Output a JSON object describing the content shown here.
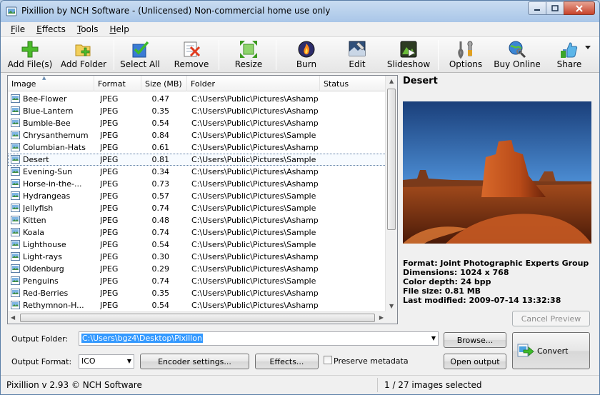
{
  "window": {
    "title": "Pixillion by NCH Software - (Unlicensed) Non-commercial home use only"
  },
  "menu": [
    {
      "first": "F",
      "rest": "ile"
    },
    {
      "first": "E",
      "rest": "ffects"
    },
    {
      "first": "T",
      "rest": "ools"
    },
    {
      "first": "H",
      "rest": "elp"
    }
  ],
  "toolbar": {
    "add_files": "Add File(s)",
    "add_folder": "Add Folder",
    "select_all": "Select All",
    "remove": "Remove",
    "resize": "Resize",
    "burn": "Burn",
    "edit": "Edit",
    "slideshow": "Slideshow",
    "options": "Options",
    "buy_online": "Buy Online",
    "share": "Share"
  },
  "list": {
    "columns": {
      "image": "Image",
      "format": "Format",
      "size": "Size (MB)",
      "folder": "Folder",
      "status": "Status"
    },
    "rows": [
      {
        "name": "Bee-Flower",
        "format": "JPEG",
        "size": "0.47",
        "folder": "C:\\Users\\Public\\Pictures\\Ashamp...",
        "status": ""
      },
      {
        "name": "Blue-Lantern",
        "format": "JPEG",
        "size": "0.35",
        "folder": "C:\\Users\\Public\\Pictures\\Ashamp...",
        "status": ""
      },
      {
        "name": "Bumble-Bee",
        "format": "JPEG",
        "size": "0.54",
        "folder": "C:\\Users\\Public\\Pictures\\Ashamp...",
        "status": ""
      },
      {
        "name": "Chrysanthemum",
        "format": "JPEG",
        "size": "0.84",
        "folder": "C:\\Users\\Public\\Pictures\\Sample ...",
        "status": ""
      },
      {
        "name": "Columbian-Hats",
        "format": "JPEG",
        "size": "0.61",
        "folder": "C:\\Users\\Public\\Pictures\\Ashamp...",
        "status": ""
      },
      {
        "name": "Desert",
        "format": "JPEG",
        "size": "0.81",
        "folder": "C:\\Users\\Public\\Pictures\\Sample ...",
        "status": ""
      },
      {
        "name": "Evening-Sun",
        "format": "JPEG",
        "size": "0.34",
        "folder": "C:\\Users\\Public\\Pictures\\Ashamp...",
        "status": ""
      },
      {
        "name": "Horse-in-the-...",
        "format": "JPEG",
        "size": "0.73",
        "folder": "C:\\Users\\Public\\Pictures\\Ashamp...",
        "status": ""
      },
      {
        "name": "Hydrangeas",
        "format": "JPEG",
        "size": "0.57",
        "folder": "C:\\Users\\Public\\Pictures\\Sample ...",
        "status": ""
      },
      {
        "name": "Jellyfish",
        "format": "JPEG",
        "size": "0.74",
        "folder": "C:\\Users\\Public\\Pictures\\Sample ...",
        "status": ""
      },
      {
        "name": "Kitten",
        "format": "JPEG",
        "size": "0.48",
        "folder": "C:\\Users\\Public\\Pictures\\Ashamp...",
        "status": ""
      },
      {
        "name": "Koala",
        "format": "JPEG",
        "size": "0.74",
        "folder": "C:\\Users\\Public\\Pictures\\Sample ...",
        "status": ""
      },
      {
        "name": "Lighthouse",
        "format": "JPEG",
        "size": "0.54",
        "folder": "C:\\Users\\Public\\Pictures\\Sample ...",
        "status": ""
      },
      {
        "name": "Light-rays",
        "format": "JPEG",
        "size": "0.30",
        "folder": "C:\\Users\\Public\\Pictures\\Ashamp...",
        "status": ""
      },
      {
        "name": "Oldenburg",
        "format": "JPEG",
        "size": "0.29",
        "folder": "C:\\Users\\Public\\Pictures\\Ashamp...",
        "status": ""
      },
      {
        "name": "Penguins",
        "format": "JPEG",
        "size": "0.74",
        "folder": "C:\\Users\\Public\\Pictures\\Sample ...",
        "status": ""
      },
      {
        "name": "Red-Berries",
        "format": "JPEG",
        "size": "0.35",
        "folder": "C:\\Users\\Public\\Pictures\\Ashamp...",
        "status": ""
      },
      {
        "name": "Rethymnon-H...",
        "format": "JPEG",
        "size": "0.54",
        "folder": "C:\\Users\\Public\\Pictures\\Ashamp...",
        "status": ""
      }
    ],
    "selected_index": 5
  },
  "preview": {
    "title": "Desert",
    "format": "Format: Joint Photographic Experts Group",
    "dimensions": "Dimensions: 1024 x 768",
    "color_depth": "Color depth: 24 bpp",
    "file_size": "File size: 0.81 MB",
    "last_modified": "Last modified: 2009-07-14 13:32:38",
    "cancel_preview": "Cancel Preview"
  },
  "output": {
    "folder_label": "Output Folder:",
    "folder_value": "C:\\Users\\bgz4\\Desktop\\Pixillon",
    "browse": "Browse...",
    "format_label": "Output Format:",
    "format_value": "ICO",
    "encoder_settings": "Encoder settings...",
    "effects": "Effects...",
    "preserve_metadata": "Preserve metadata",
    "open_output": "Open output",
    "convert": "Convert"
  },
  "status": {
    "version": "Pixillion v 2.93 © NCH Software",
    "selection": "1 / 27 images selected"
  },
  "colors": {
    "accent": "#3399ff",
    "title_bar": "#b6cfeb"
  }
}
